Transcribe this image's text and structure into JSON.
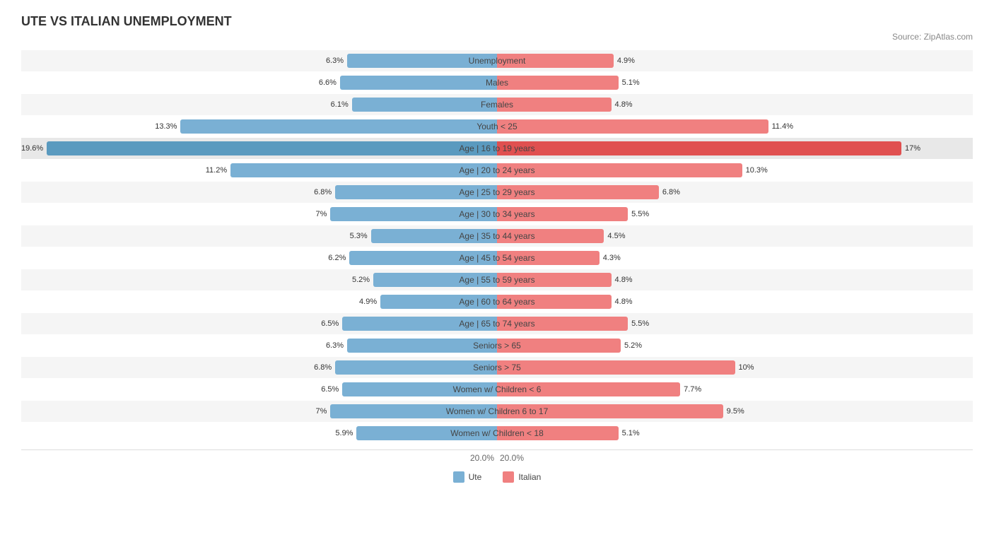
{
  "title": "UTE VS ITALIAN UNEMPLOYMENT",
  "source": "Source: ZipAtlas.com",
  "axis": {
    "left": "20.0%",
    "right": "20.0%"
  },
  "legend": {
    "ute_label": "Ute",
    "italian_label": "Italian",
    "ute_color": "#7ab0d4",
    "italian_color": "#f08080"
  },
  "rows": [
    {
      "label": "Unemployment",
      "ute": 6.3,
      "italian": 4.9,
      "ute_pct": 6.3,
      "italian_pct": 4.9
    },
    {
      "label": "Males",
      "ute": 6.6,
      "italian": 5.1,
      "ute_pct": 6.6,
      "italian_pct": 5.1
    },
    {
      "label": "Females",
      "ute": 6.1,
      "italian": 4.8,
      "ute_pct": 6.1,
      "italian_pct": 4.8
    },
    {
      "label": "Youth < 25",
      "ute": 13.3,
      "italian": 11.4,
      "ute_pct": 13.3,
      "italian_pct": 11.4
    },
    {
      "label": "Age | 16 to 19 years",
      "ute": 19.6,
      "italian": 17.0,
      "ute_pct": 19.6,
      "italian_pct": 17.0,
      "highlight": true
    },
    {
      "label": "Age | 20 to 24 years",
      "ute": 11.2,
      "italian": 10.3,
      "ute_pct": 11.2,
      "italian_pct": 10.3
    },
    {
      "label": "Age | 25 to 29 years",
      "ute": 6.8,
      "italian": 6.8,
      "ute_pct": 6.8,
      "italian_pct": 6.8
    },
    {
      "label": "Age | 30 to 34 years",
      "ute": 7.0,
      "italian": 5.5,
      "ute_pct": 7.0,
      "italian_pct": 5.5
    },
    {
      "label": "Age | 35 to 44 years",
      "ute": 5.3,
      "italian": 4.5,
      "ute_pct": 5.3,
      "italian_pct": 4.5
    },
    {
      "label": "Age | 45 to 54 years",
      "ute": 6.2,
      "italian": 4.3,
      "ute_pct": 6.2,
      "italian_pct": 4.3
    },
    {
      "label": "Age | 55 to 59 years",
      "ute": 5.2,
      "italian": 4.8,
      "ute_pct": 5.2,
      "italian_pct": 4.8
    },
    {
      "label": "Age | 60 to 64 years",
      "ute": 4.9,
      "italian": 4.8,
      "ute_pct": 4.9,
      "italian_pct": 4.8
    },
    {
      "label": "Age | 65 to 74 years",
      "ute": 6.5,
      "italian": 5.5,
      "ute_pct": 6.5,
      "italian_pct": 5.5
    },
    {
      "label": "Seniors > 65",
      "ute": 6.3,
      "italian": 5.2,
      "ute_pct": 6.3,
      "italian_pct": 5.2
    },
    {
      "label": "Seniors > 75",
      "ute": 6.8,
      "italian": 10.0,
      "ute_pct": 6.8,
      "italian_pct": 10.0
    },
    {
      "label": "Women w/ Children < 6",
      "ute": 6.5,
      "italian": 7.7,
      "ute_pct": 6.5,
      "italian_pct": 7.7
    },
    {
      "label": "Women w/ Children 6 to 17",
      "ute": 7.0,
      "italian": 9.5,
      "ute_pct": 7.0,
      "italian_pct": 9.5
    },
    {
      "label": "Women w/ Children < 18",
      "ute": 5.9,
      "italian": 5.1,
      "ute_pct": 5.9,
      "italian_pct": 5.1
    }
  ],
  "max_value": 20.0
}
